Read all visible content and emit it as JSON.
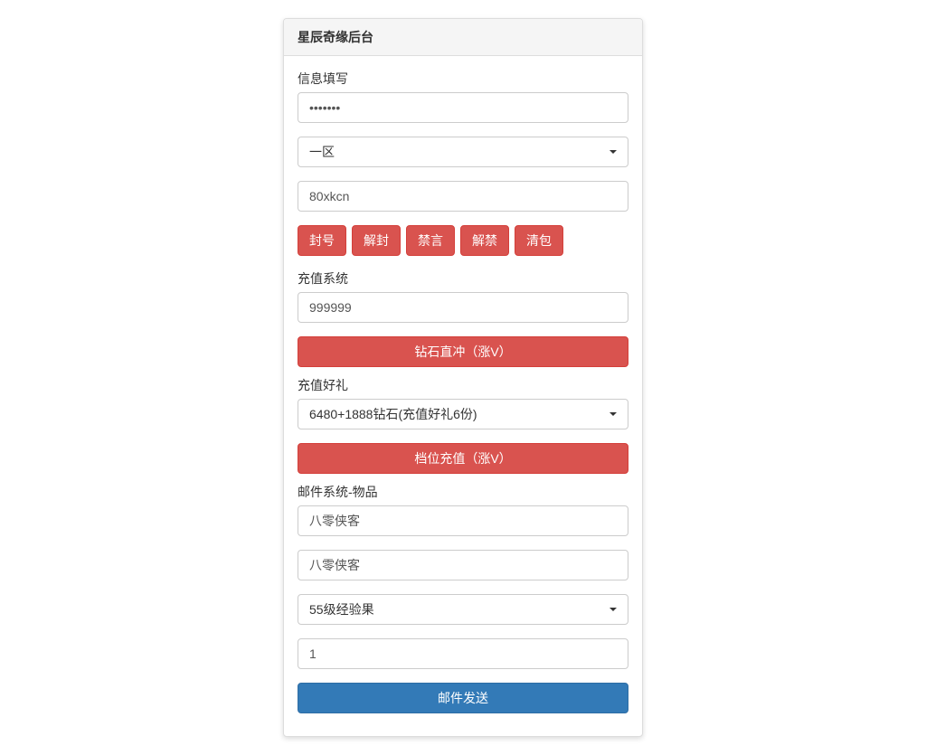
{
  "panel": {
    "title": "星辰奇缘后台"
  },
  "info": {
    "label": "信息填写",
    "password_value": "•••••••",
    "zone_selected": "一区",
    "id_value": "80xkcn"
  },
  "ban_buttons": {
    "ban": "封号",
    "unban": "解封",
    "mute": "禁言",
    "unmute": "解禁",
    "clear_bag": "清包"
  },
  "recharge": {
    "label": "充值系统",
    "amount_value": "999999",
    "direct_button": "钻石直冲（涨V）",
    "gift_label": "充值好礼",
    "gift_selected": "6480+1888钻石(充值好礼6份)",
    "tier_button": "档位充值（涨V）"
  },
  "mail": {
    "label": "邮件系统-物品",
    "field1_value": "八零侠客",
    "field2_value": "八零侠客",
    "item_selected": "55级经验果",
    "quantity_value": "1",
    "send_button": "邮件发送"
  }
}
